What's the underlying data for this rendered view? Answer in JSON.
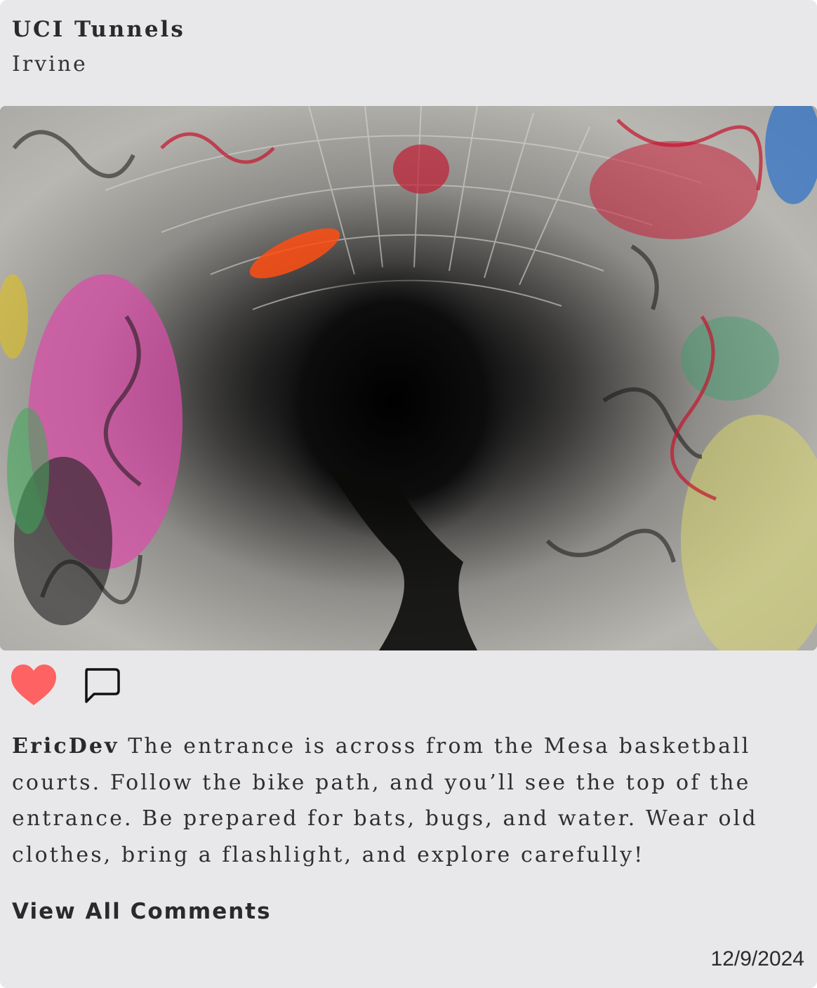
{
  "post": {
    "title": "UCI Tunnels",
    "location": "Irvine",
    "photo": {
      "subject": "graffiti-tunnel-photo"
    },
    "actions": {
      "like_icon": "heart-icon",
      "comment_icon": "comment-icon",
      "liked": true
    },
    "caption": {
      "username": "EricDev",
      "text": "The entrance is across from the Mesa basketball courts. Follow the bike path, and you’ll see the top of the entrance. Be prepared for bats, bugs, and water. Wear old clothes, bring a flashlight, and explore carefully!"
    },
    "view_all_comments_label": "View All Comments",
    "date": "12/9/2024"
  },
  "colors": {
    "card_background": "#e8e8ea",
    "heart": "#ff6263",
    "text": "#2a2a2a"
  }
}
